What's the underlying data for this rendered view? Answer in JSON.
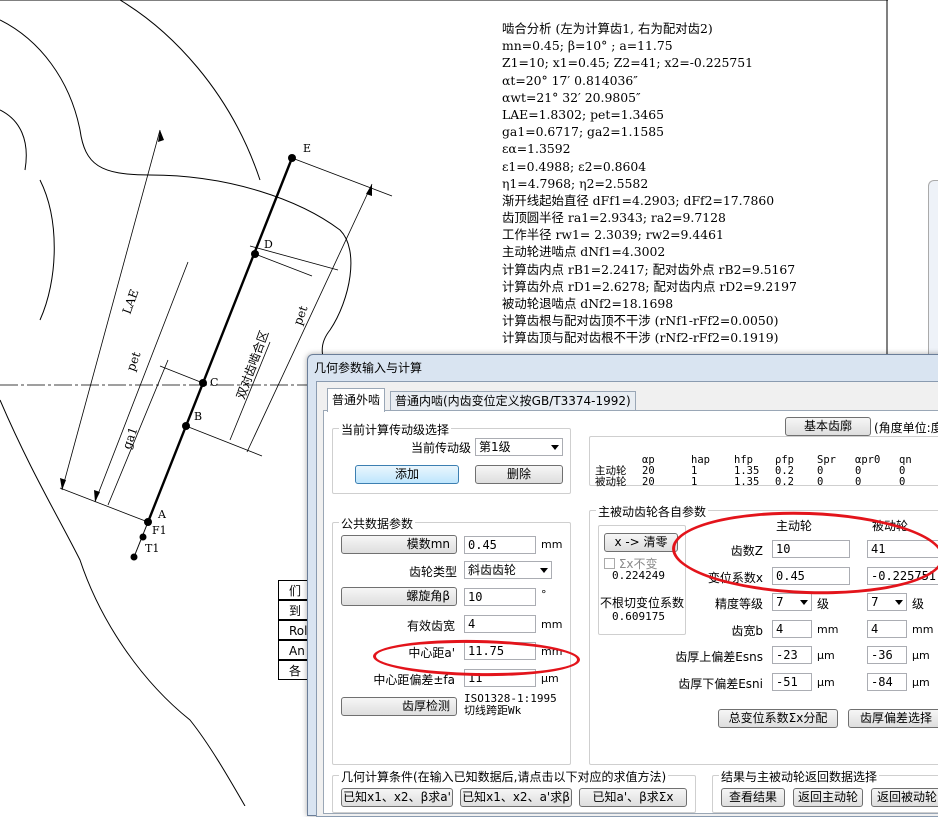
{
  "cad": {
    "point_labels": [
      "E",
      "D",
      "C",
      "B",
      "A",
      "F1",
      "T1"
    ],
    "dim_labels": {
      "lae": "LAE",
      "pet_left": "pet",
      "ga1": "ga1",
      "pet_right": "pet",
      "double_contact": "双对齿啮合区"
    },
    "table_cells": [
      "们",
      "到",
      "Rol",
      "An",
      "各"
    ],
    "analysis_lines": [
      "啮合分析 (左为计算齿1, 右为配对齿2)",
      "mn=0.45; β=10° ; a=11.75",
      "Z1=10; x1=0.45; Z2=41; x2=-0.225751",
      "αt=20° 17′ 0.814036″",
      "αwt=21° 32′ 20.9805″",
      "LAE=1.8302; pet=1.3465",
      "ga1=0.6717; ga2=1.1585",
      "εα=1.3592",
      "ε1=0.4988; ε2=0.8604",
      "η1=4.7968; η2=2.5582",
      "渐开线起始直径 dFf1=4.2903; dFf2=17.7860",
      "齿顶圆半径 ra1=2.9343; ra2=9.7128",
      "工作半径 rw1= 2.3039; rw2=9.4461",
      "主动轮进啮点 dNf1=4.3002",
      "计算齿内点 rB1=2.2417; 配对齿外点 rB2=9.5167",
      "计算齿外点 rD1=2.6278; 配对齿内点 rD2=9.2197",
      "被动轮退啮点 dNf2=18.1698",
      "计算齿根与配对齿顶不干涉 (rNf1-rFf2=0.0050)",
      "计算齿顶与配对齿根不干涉 (rNf2-rFf2=0.1919)"
    ]
  },
  "dialog": {
    "title": "几何参数输入与计算",
    "tabs": [
      "普通外啮",
      "普通内啮(内齿变位定义按GB/T3374-1992)"
    ],
    "stage_group": {
      "title": "当前计算传动级选择",
      "label": "当前传动级",
      "value": "第1级",
      "add_button": "添加",
      "delete_button": "删除"
    },
    "basic_profile": {
      "button": "基本齿廓",
      "unit_note": "(角度单位:度",
      "headers": [
        "αp",
        "hap",
        "hfp",
        "ρfp",
        "Spr",
        "αpr0",
        "qn"
      ],
      "rows": [
        {
          "name": "主动轮",
          "values": [
            "20",
            "1",
            "1.35",
            "0.2",
            "0",
            "0",
            "0"
          ]
        },
        {
          "name": "被动轮",
          "values": [
            "20",
            "1",
            "1.35",
            "0.2",
            "0",
            "0",
            "0"
          ]
        }
      ]
    },
    "common_group": {
      "title": "公共数据参数",
      "module_button": "模数mn",
      "module_value": "0.45",
      "module_unit": "mm",
      "gear_type_label": "齿轮类型",
      "gear_type_value": "斜齿齿轮",
      "helix_button": "螺旋角β",
      "helix_value": "10",
      "helix_unit": "°",
      "face_width_label": "有效齿宽",
      "face_width_value": "4",
      "face_width_unit": "mm",
      "center_label": "中心距a'",
      "center_value": "11.75",
      "center_unit": "mm",
      "center_tol_label": "中心距偏差±fa",
      "center_tol_value": "11",
      "center_tol_unit": "μm",
      "thickness_button": "齿厚检测",
      "std_line1": "ISO1328-1:1995",
      "std_line2": "切线跨距Wk"
    },
    "gear_group": {
      "title": "主被动齿轮各自参数",
      "clear_button": "x -> 清零",
      "sum_x_label": "Σx不变",
      "sum_x_value": "0.224249",
      "no_undercut_label": "不根切变位系数",
      "no_undercut_value": "0.609175",
      "driving_header": "主动轮",
      "driven_header": "被动轮",
      "teeth_label": "齿数Z",
      "teeth_driving": "10",
      "teeth_driven": "41",
      "shift_label": "变位系数x",
      "shift_driving": "0.45",
      "shift_driven": "-0.225751",
      "grade_label": "精度等级",
      "grade_driving": "7",
      "grade_driven": "7",
      "grade_unit": "级",
      "width_label": "齿宽b",
      "width_driving": "4",
      "width_driven": "4",
      "width_unit": "mm",
      "upper_dev_label": "齿厚上偏差Esns",
      "upper_dev_driving": "-23",
      "upper_dev_driven": "-36",
      "lower_dev_label": "齿厚下偏差Esni",
      "lower_dev_driving": "-51",
      "lower_dev_driven": "-84",
      "dev_unit": "μm",
      "sum_alloc_button": "总变位系数Σx分配",
      "thickness_dev_button": "齿厚偏差选择"
    },
    "calc_group": {
      "title": "几何计算条件(在输入已知数据后,请点击以下对应的求值方法)",
      "buttons": [
        "已知x1、x2、β求a'",
        "已知x1、x2、a'求β",
        "已知a'、β求Σx"
      ]
    },
    "result_group": {
      "title": "结果与主被动轮返回数据选择",
      "buttons": [
        "查看结果",
        "返回主动轮",
        "返回被动轮"
      ]
    }
  },
  "colors": {
    "annotation_red": "#e3141b",
    "cad_line": "#000000",
    "dialog_frame": "#d9e4f1"
  }
}
